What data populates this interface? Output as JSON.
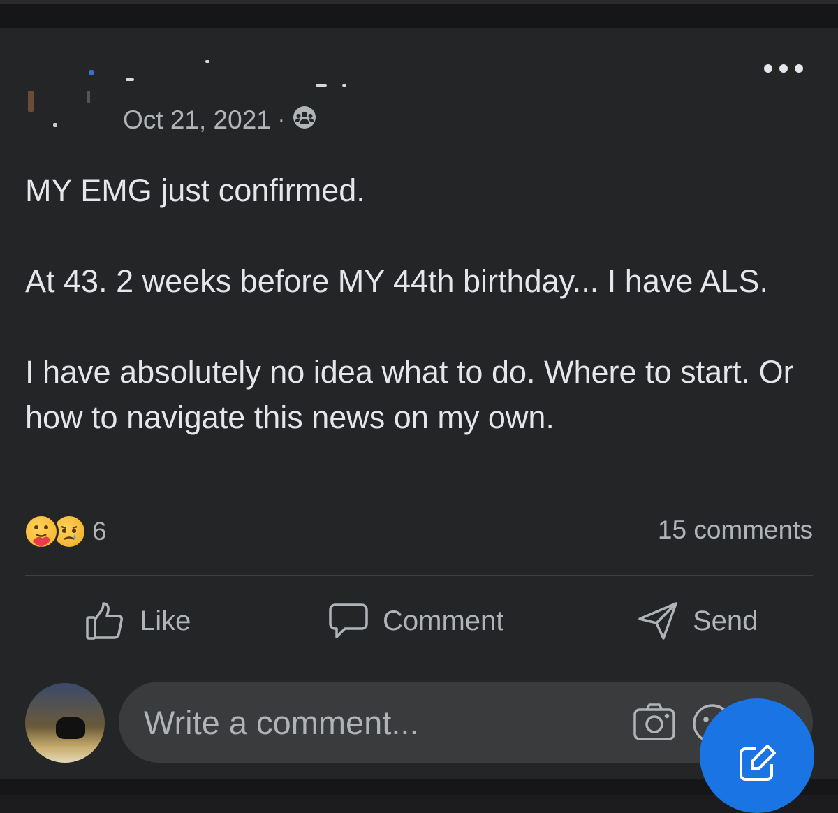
{
  "post": {
    "date": "Oct 21, 2021",
    "separator": "·",
    "audience_icon": "group-icon",
    "paragraphs": [
      "MY EMG just confirmed.",
      "At 43. 2 weeks before MY 44th birthday... I have ALS.",
      "I have absolutely no idea what to do. Where to start. Or how to navigate this news on my own."
    ],
    "reactions": {
      "icons": [
        "care-reaction-icon",
        "sad-reaction-icon"
      ],
      "count": "6"
    },
    "comments_count": "15 comments"
  },
  "actions": {
    "like": "Like",
    "comment": "Comment",
    "send": "Send"
  },
  "comment_box": {
    "placeholder": "Write a comment..."
  },
  "colors": {
    "background": "#242526",
    "text": "#e4e6eb",
    "secondary_text": "#b0b3b8",
    "accent": "#1b74e4"
  }
}
